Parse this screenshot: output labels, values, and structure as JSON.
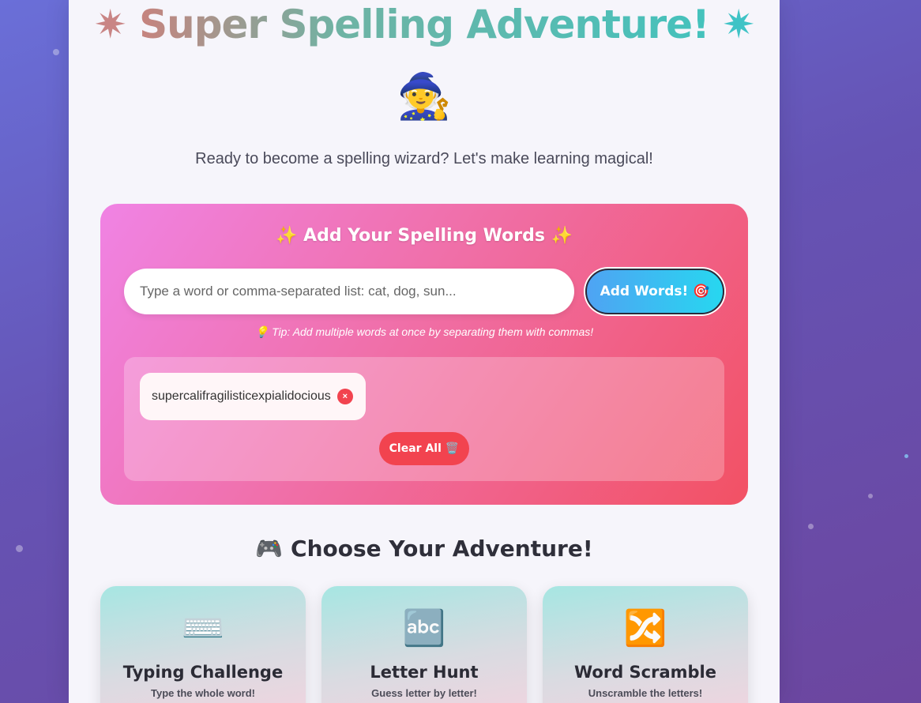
{
  "header": {
    "star_left": "✷",
    "title": "Super Spelling Adventure!",
    "star_right": "✷",
    "mascot": "🧙",
    "subtitle": "Ready to become a spelling wizard? Let's make learning magical!"
  },
  "add_words": {
    "title": "✨ Add Your Spelling Words ✨",
    "input_placeholder": "Type a word or comma-separated list: cat, dog, sun...",
    "input_value": "",
    "add_button_label": "Add Words!",
    "add_button_icon": "🎯",
    "tip": "💡 Tip: Add multiple words at once by separating them with commas!",
    "words": [
      "supercalifragilisticexpialidocious"
    ],
    "remove_icon": "×",
    "clear_button_label": "Clear All",
    "clear_button_icon": "🗑️"
  },
  "adventure": {
    "title": "🎮 Choose Your Adventure!",
    "modes": [
      {
        "icon": "⌨️",
        "title": "Typing Challenge",
        "desc": "Type the whole word!"
      },
      {
        "icon": "🔤",
        "title": "Letter Hunt",
        "desc": "Guess letter by letter!"
      },
      {
        "icon": "🔀",
        "title": "Word Scramble",
        "desc": "Unscramble the letters!"
      }
    ]
  },
  "colors": {
    "card_gradient_start": "#f083e4",
    "card_gradient_end": "#f25164",
    "add_button": "#27d7f0",
    "clear_button": "#f2434f",
    "background": "#6553b4"
  }
}
